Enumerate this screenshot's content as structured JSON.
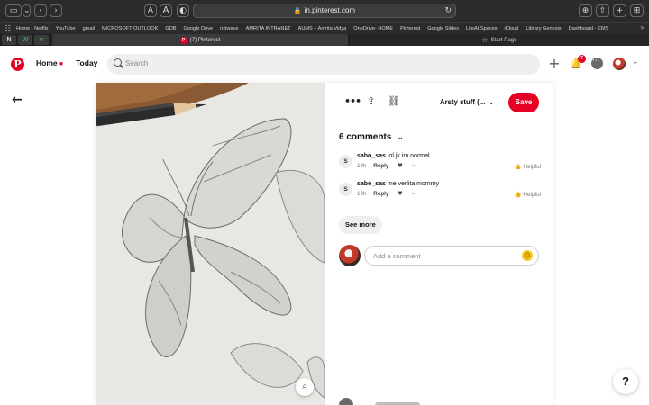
{
  "browser": {
    "toolbar": {
      "sidebar_icon": "sidebar-icon",
      "back_icon": "‹",
      "forward_icon": "›",
      "font_small": "A",
      "font_large": "A",
      "shield_icon": "◐",
      "url": "in.pinterest.com",
      "reload_icon": "↻",
      "download_icon": "⊕",
      "share_icon": "⇧",
      "new_tab_icon": "+",
      "tabs_icon": "⊞"
    },
    "bookmarks": [
      "Home - Netflix",
      "YouTube",
      "gmail",
      "MICROSOFT OUTLOOK",
      "GDB",
      "Google Drive",
      "nxtwave",
      "AMRITA INTRANET",
      "AUMS – Amrita Vidya",
      "OneDrive- HOME",
      "Pinterest",
      "Google Slides",
      "LifeAt Spaces",
      "iCloud",
      "Library Genesis",
      "Dashboard - CMS"
    ],
    "tabs": {
      "active_label": "(7) Pinterest",
      "inactive_label": "Start Page"
    },
    "pinned_tabs": [
      "N",
      "W",
      "≋"
    ]
  },
  "header": {
    "home": "Home",
    "today": "Today",
    "search_placeholder": "Search",
    "notification_count": "7"
  },
  "pin": {
    "board": "Arsty stuff (...",
    "save": "Save",
    "comments_title": "6 comments",
    "comments": [
      {
        "avatar": "S",
        "user": "sabo_sas",
        "text": "lol jk im normal",
        "age": "19h",
        "reply": "Reply",
        "helpful": "Helpful"
      },
      {
        "avatar": "S",
        "user": "sabo_sas",
        "text": "me verlita mommy",
        "age": "19h",
        "reply": "Reply",
        "helpful": "Helpful"
      }
    ],
    "see_more": "See more",
    "comment_placeholder": "Add a comment"
  },
  "help": "?",
  "colors": {
    "pinterest_red": "#e60023",
    "browser_dark": "#2b2b2d"
  }
}
